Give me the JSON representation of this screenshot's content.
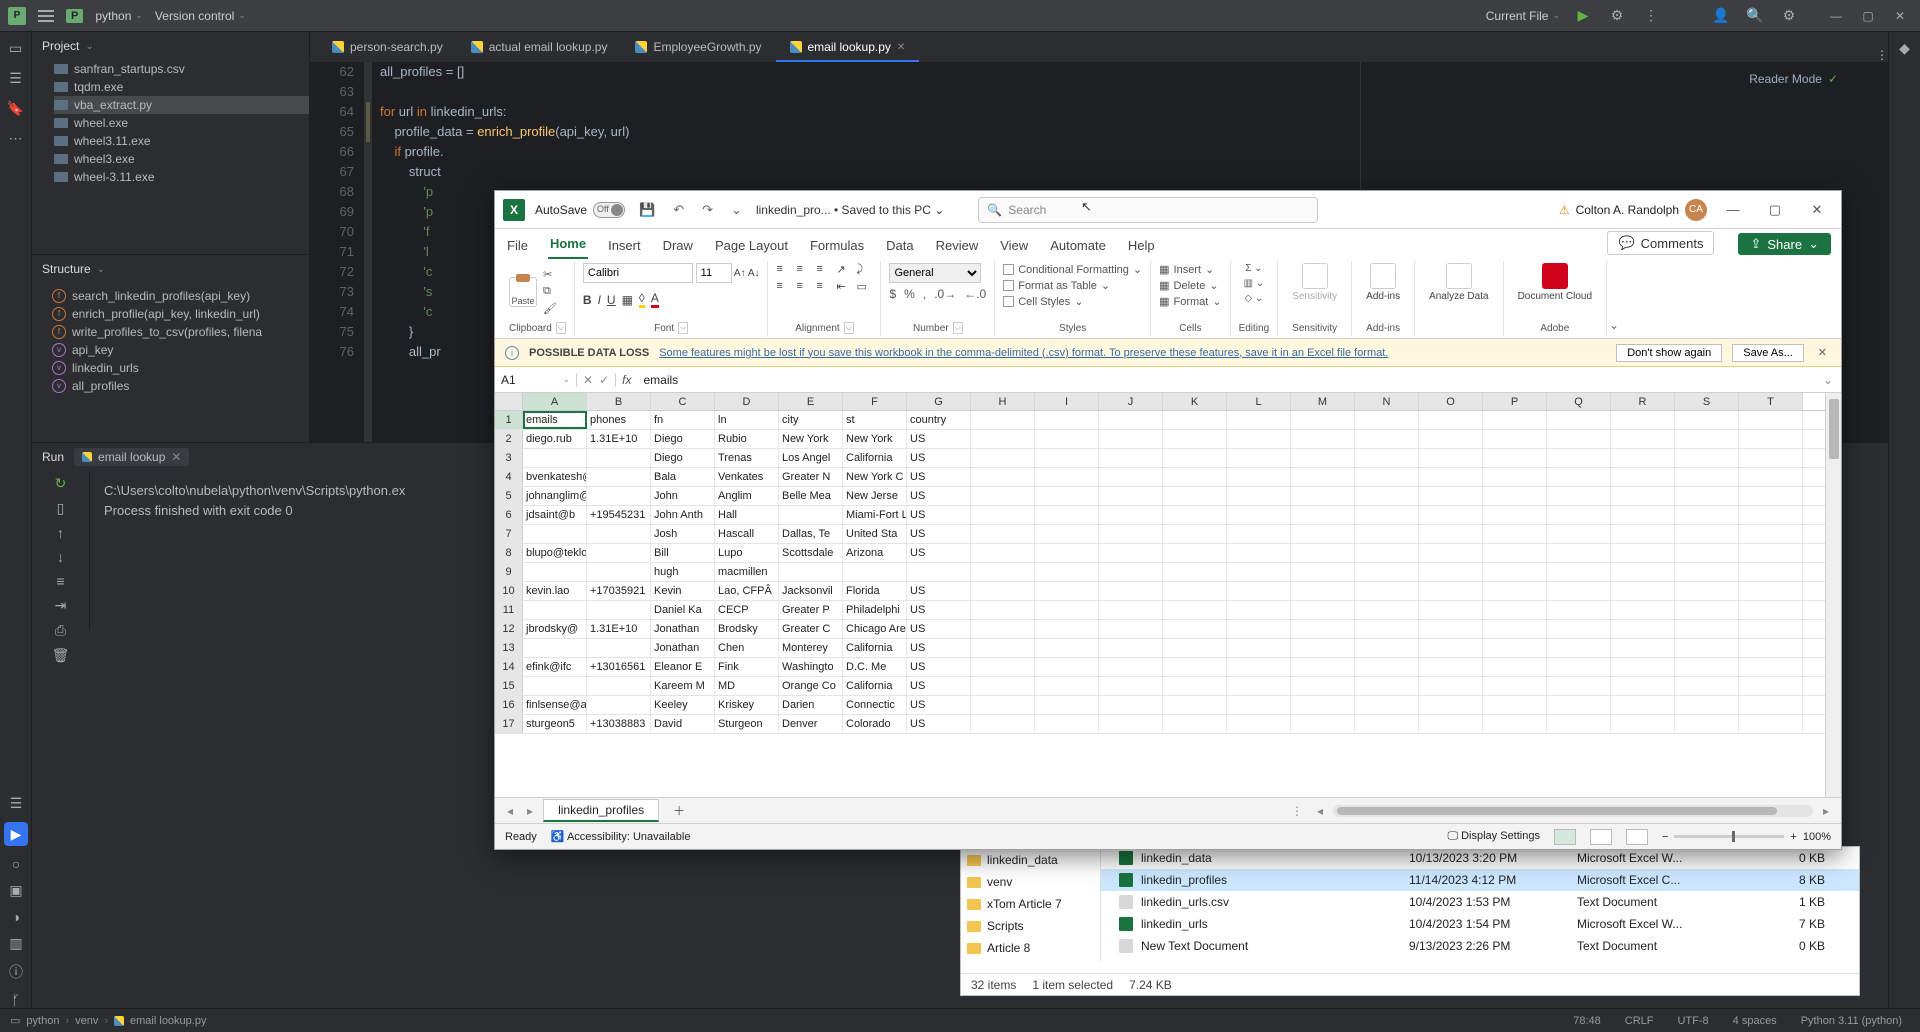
{
  "ide": {
    "project_badge": "P",
    "project_name": "python",
    "vc_label": "Version control",
    "run_config": "Current File",
    "project_header": "Project",
    "project_files": [
      "sanfran_startups.csv",
      "tqdm.exe",
      "vba_extract.py",
      "wheel.exe",
      "wheel3.11.exe",
      "wheel3.exe",
      "wheel-3.11.exe"
    ],
    "structure_header": "Structure",
    "structure_items": [
      {
        "k": "f",
        "t": "search_linkedin_profiles(api_key)"
      },
      {
        "k": "f",
        "t": "enrich_profile(api_key, linkedin_url)"
      },
      {
        "k": "f",
        "t": "write_profiles_to_csv(profiles, filena"
      },
      {
        "k": "v",
        "t": "api_key"
      },
      {
        "k": "v",
        "t": "linkedin_urls"
      },
      {
        "k": "v",
        "t": "all_profiles"
      }
    ],
    "tabs": [
      {
        "t": "person-search.py",
        "active": false
      },
      {
        "t": "actual email lookup.py",
        "active": false
      },
      {
        "t": "EmployeeGrowth.py",
        "active": false
      },
      {
        "t": "email lookup.py",
        "active": true
      }
    ],
    "reader_mode": "Reader Mode",
    "gutter_start": 62,
    "gutter_count": 15,
    "code_lines": [
      "all_profiles = []",
      "",
      "for url in linkedin_urls:",
      "    profile_data = enrich_profile(api_key, url)",
      "    if profile.",
      "        struct",
      "            'p",
      "            'p",
      "            'f",
      "            'l",
      "            'c",
      "            's",
      "            'c",
      "        }",
      "        all_pr"
    ],
    "run_tab_title": "Run",
    "run_tab_config": "email lookup",
    "run_output": [
      "C:\\Users\\colto\\nubela\\python\\venv\\Scripts\\python.ex",
      "",
      "Process finished with exit code 0"
    ],
    "breadcrumb": [
      "python",
      "venv",
      "email lookup.py"
    ],
    "status_right": [
      "78:48",
      "CRLF",
      "UTF-8",
      "4 spaces",
      "Python 3.11 (python)"
    ]
  },
  "explorer": {
    "nav": [
      "linkedin_data",
      "venv",
      "xTom Article 7",
      "Scripts",
      "Article 8"
    ],
    "rows": [
      {
        "sel": false,
        "icon": "xl",
        "name": "linkedin_data",
        "date": "10/13/2023 3:20 PM",
        "type": "Microsoft Excel W...",
        "size": "0 KB"
      },
      {
        "sel": true,
        "icon": "xl",
        "name": "linkedin_profiles",
        "date": "11/14/2023 4:12 PM",
        "type": "Microsoft Excel C...",
        "size": "8 KB"
      },
      {
        "sel": false,
        "icon": "txt",
        "name": "linkedin_urls.csv",
        "date": "10/4/2023 1:53 PM",
        "type": "Text Document",
        "size": "1 KB"
      },
      {
        "sel": false,
        "icon": "xl",
        "name": "linkedin_urls",
        "date": "10/4/2023 1:54 PM",
        "type": "Microsoft Excel W...",
        "size": "7 KB"
      },
      {
        "sel": false,
        "icon": "txt",
        "name": "New Text Document",
        "date": "9/13/2023 2:26 PM",
        "type": "Text Document",
        "size": "0 KB"
      }
    ],
    "status": {
      "items": "32 items",
      "sel": "1 item selected",
      "size": "7.24 KB"
    }
  },
  "excel": {
    "autosave_label": "AutoSave",
    "autosave_off": "Off",
    "filename": "linkedin_pro...",
    "saved": "Saved to this PC",
    "search_placeholder": "Search",
    "user_name": "Colton A. Randolph",
    "user_initials": "CA",
    "ribbon_tabs": [
      "File",
      "Home",
      "Insert",
      "Draw",
      "Page Layout",
      "Formulas",
      "Data",
      "Review",
      "View",
      "Automate",
      "Help"
    ],
    "active_ribbon_tab": "Home",
    "comments_btn": "Comments",
    "share_btn": "Share",
    "groups": {
      "clipboard": "Clipboard",
      "paste": "Paste",
      "font": "Font",
      "font_family": "Calibri",
      "font_size": "11",
      "alignment": "Alignment",
      "number": "Number",
      "number_format": "General",
      "styles": "Styles",
      "cond_fmt": "Conditional Formatting",
      "as_table": "Format as Table",
      "cell_styles": "Cell Styles",
      "cells": "Cells",
      "insert": "Insert",
      "delete": "Delete",
      "format": "Format",
      "editing": "Editing",
      "sensitivity": "Sensitivity",
      "addins": "Add-ins",
      "analyze": "Analyze Data",
      "adobe": "Document Cloud",
      "adobe_grp": "Adobe"
    },
    "msgbar": {
      "title": "POSSIBLE DATA LOSS",
      "msg": "Some features might be lost if you save this workbook in the comma-delimited (.csv) format. To preserve these features, save it in an Excel file format.",
      "btn1": "Don't show again",
      "btn2": "Save As..."
    },
    "namebox": "A1",
    "formula": "emails",
    "columns": [
      "A",
      "B",
      "C",
      "D",
      "E",
      "F",
      "G",
      "H",
      "I",
      "J",
      "K",
      "L",
      "M",
      "N",
      "O",
      "P",
      "Q",
      "R",
      "S",
      "T"
    ],
    "active_col": "A",
    "active_row": 1,
    "rows": [
      [
        "emails",
        "phones",
        "fn",
        "ln",
        "city",
        "st",
        "country"
      ],
      [
        "diego.rub",
        "1.31E+10",
        "Diego",
        "Rubio",
        "New York",
        "New York",
        "US"
      ],
      [
        "",
        "",
        "Diego",
        "Trenas",
        "Los Angel",
        "California",
        "US"
      ],
      [
        "bvenkatesh@comca",
        "",
        "Bala",
        "Venkates",
        "Greater N",
        "New York C",
        "US"
      ],
      [
        "johnanglim@att.net",
        "",
        "John",
        "Anglim",
        "Belle Mea",
        "New Jerse",
        "US"
      ],
      [
        "jdsaint@b",
        "+19545231",
        "John Anth",
        "Hall",
        "",
        "Miami-Fort Lauderd",
        "US"
      ],
      [
        "",
        "",
        "Josh",
        "Hascall",
        "Dallas, Te",
        "United Sta",
        "US"
      ],
      [
        "blupo@tekloans.cor",
        "",
        "Bill",
        "Lupo",
        "Scottsdale",
        "Arizona",
        "US"
      ],
      [
        "",
        "",
        "hugh",
        "macmillen",
        "",
        "",
        ""
      ],
      [
        "kevin.lao",
        "+17035921",
        "Kevin",
        "Lao, CFPÂ",
        "Jacksonvil",
        "Florida",
        "US"
      ],
      [
        "",
        "",
        "Daniel Ka",
        "CECP",
        "Greater P",
        "Philadelphi",
        "US"
      ],
      [
        "jbrodsky@",
        "1.31E+10",
        "Jonathan",
        "Brodsky",
        "Greater C",
        "Chicago Are",
        "US"
      ],
      [
        "",
        "",
        "Jonathan",
        "Chen",
        "Monterey",
        "California",
        "US"
      ],
      [
        "efink@ifc",
        "+13016561",
        "Eleanor E",
        "Fink",
        "Washingto",
        "D.C. Me",
        "US"
      ],
      [
        "",
        "",
        "Kareem M",
        "MD",
        "Orange Co",
        "California",
        "US"
      ],
      [
        "finlsense@aol.com",
        "",
        "Keeley",
        "Kriskey",
        "Darien",
        "Connectic",
        "US"
      ],
      [
        "sturgeon5",
        "+13038883",
        "David",
        "Sturgeon",
        "Denver",
        "Colorado",
        "US"
      ]
    ],
    "sheet_name": "linkedin_profiles",
    "status": {
      "ready": "Ready",
      "access": "Accessibility: Unavailable",
      "display": "Display Settings",
      "zoom": "100%"
    }
  }
}
